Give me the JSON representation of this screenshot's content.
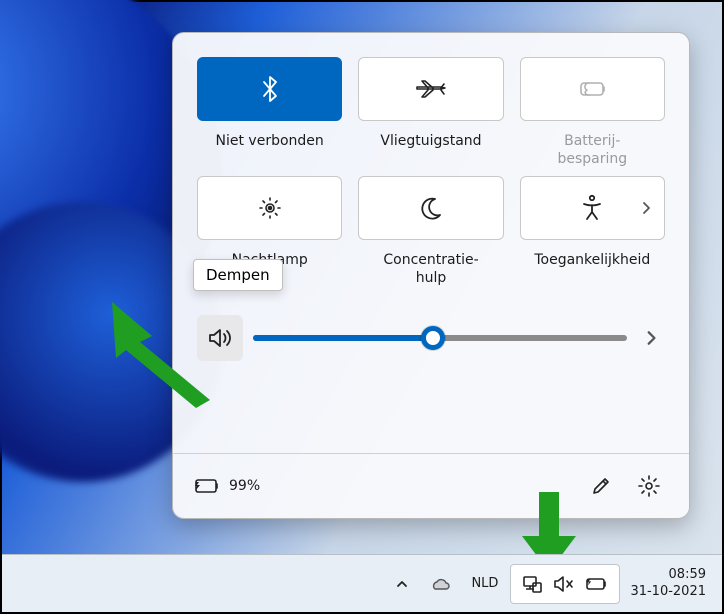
{
  "tiles": {
    "bluetooth": {
      "label": "Niet verbonden"
    },
    "airplane": {
      "label": "Vliegtuigstand"
    },
    "battery": {
      "label": "Batterij-\nbesparing"
    },
    "nightlight": {
      "label": "Nachtlamp"
    },
    "focus": {
      "label": "Concentratie-\nhulp"
    },
    "accessibility": {
      "label": "Toegankelijkheid"
    }
  },
  "volume": {
    "tooltip": "Dempen",
    "percent": 48
  },
  "battery_status": "99%",
  "taskbar": {
    "language": "NLD",
    "time": "08:59",
    "date": "31-10-2021"
  }
}
